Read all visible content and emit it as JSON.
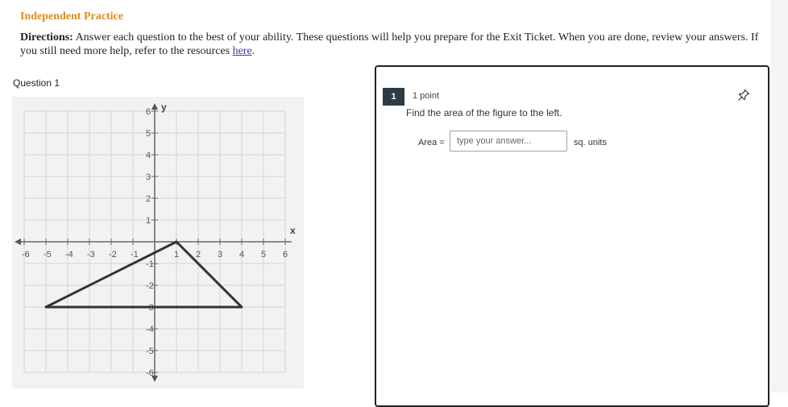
{
  "header": {
    "title": "Independent Practice",
    "directions_label": "Directions:",
    "directions_text": " Answer each question to the best of your ability. These questions will help you prepare for the Exit Ticket. When you are done, review your answers. If you still need more help, refer to the resources ",
    "link_text": "here",
    "directions_end": "."
  },
  "question": {
    "label": "Question 1",
    "graph": {
      "x_axis_label": "x",
      "y_axis_label": "y",
      "x_ticks": [
        "-6",
        "-5",
        "-4",
        "-3",
        "-2",
        "-1",
        "1",
        "2",
        "3",
        "4",
        "5",
        "6"
      ],
      "y_ticks": [
        "6",
        "5",
        "4",
        "3",
        "2",
        "1",
        "-1",
        "-2",
        "-3",
        "-4",
        "-5",
        "-6"
      ],
      "triangle_vertices": [
        [
          -5,
          -3
        ],
        [
          1,
          0
        ],
        [
          4,
          -3
        ]
      ]
    }
  },
  "panel": {
    "number": "1",
    "points": "1 point",
    "prompt": "Find the area of the figure to the left.",
    "area_label": "Area =",
    "answer_placeholder": "type your answer...",
    "answer_value": "",
    "units": "sq. units",
    "pin_icon": "pin-icon"
  }
}
